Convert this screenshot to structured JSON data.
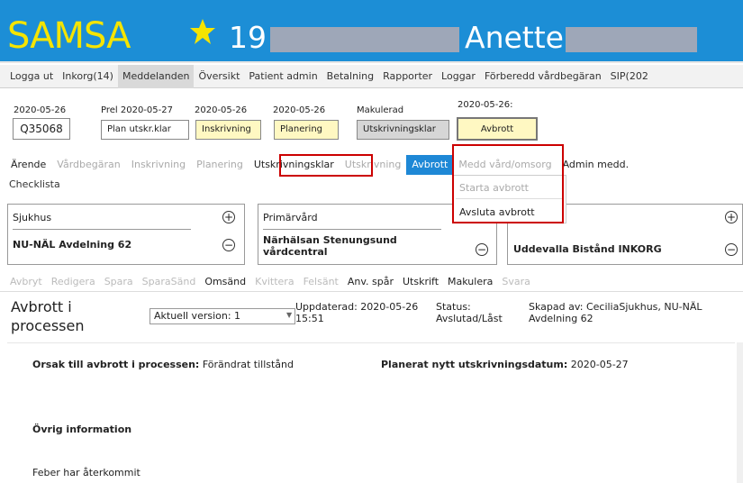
{
  "header": {
    "logo": "SAMSA",
    "patient_number": "19",
    "patient_name": "Anette",
    "brand_color": "#1c8ed6",
    "logo_color": "#f5e400",
    "star_icon": "star-icon"
  },
  "menu": [
    "Logga ut",
    "Inkorg(14)",
    "Meddelanden",
    "Översikt",
    "Patient admin",
    "Betalning",
    "Rapporter",
    "Loggar",
    "Förberedd vårdbegäran",
    "SIP(202"
  ],
  "steps": {
    "case_date": "2020-05-26",
    "case_id": "Q35068",
    "plan": {
      "date": "Prel 2020-05-27",
      "label": "Plan utskr.klar"
    },
    "inskrivning": {
      "date": "2020-05-26",
      "label": "Inskrivning"
    },
    "planering": {
      "date": "2020-05-26",
      "label": "Planering"
    },
    "utskrivningsklar": {
      "date": "Makulerad",
      "label": "Utskrivningsklar"
    },
    "avbrott": {
      "date": "2020-05-26:",
      "label": "Avbrott"
    }
  },
  "tabs": [
    "Ärende",
    "Vårdbegäran",
    "Inskrivning",
    "Planering",
    "Utskrivningsklar",
    "Utskrivning",
    "Avbrott",
    "Medd vård/omsorg",
    "Admin medd."
  ],
  "checklist": "Checklista",
  "dropdown": {
    "item1": "Starta avbrott",
    "item2": "Avsluta avbrott"
  },
  "cards": {
    "sjukhus": {
      "title": "Sjukhus",
      "value": "NU-NÄL Avdelning 62"
    },
    "primarvard": {
      "title": "Primärvård",
      "value": "Närhälsan Stenungsund vårdcentral"
    },
    "kommun": {
      "value": "Uddevalla Bistånd INKORG"
    }
  },
  "toolbar": [
    "Avbryt",
    "Redigera",
    "Spara",
    "SparaSänd",
    "Omsänd",
    "Kvittera",
    "Felsänt",
    "Anv. spår",
    "Utskrift",
    "Makulera",
    "Svara"
  ],
  "doc": {
    "title": "Avbrott i processen",
    "version": "Aktuell version: 1",
    "updated": "Uppdaterad: 2020-05-26 15:51",
    "status": "Status: Avslutad/Låst",
    "created": "Skapad av: CeciliaSjukhus, NU-NÄL Avdelning 62",
    "reason_label": "Orsak till avbrott i processen:",
    "reason_value": "Förändrat tillstånd",
    "planned_label": "Planerat nytt utskrivningsdatum:",
    "planned_value": "2020-05-27",
    "other_heading": "Övrig information",
    "other_text": "Feber har återkommit"
  }
}
